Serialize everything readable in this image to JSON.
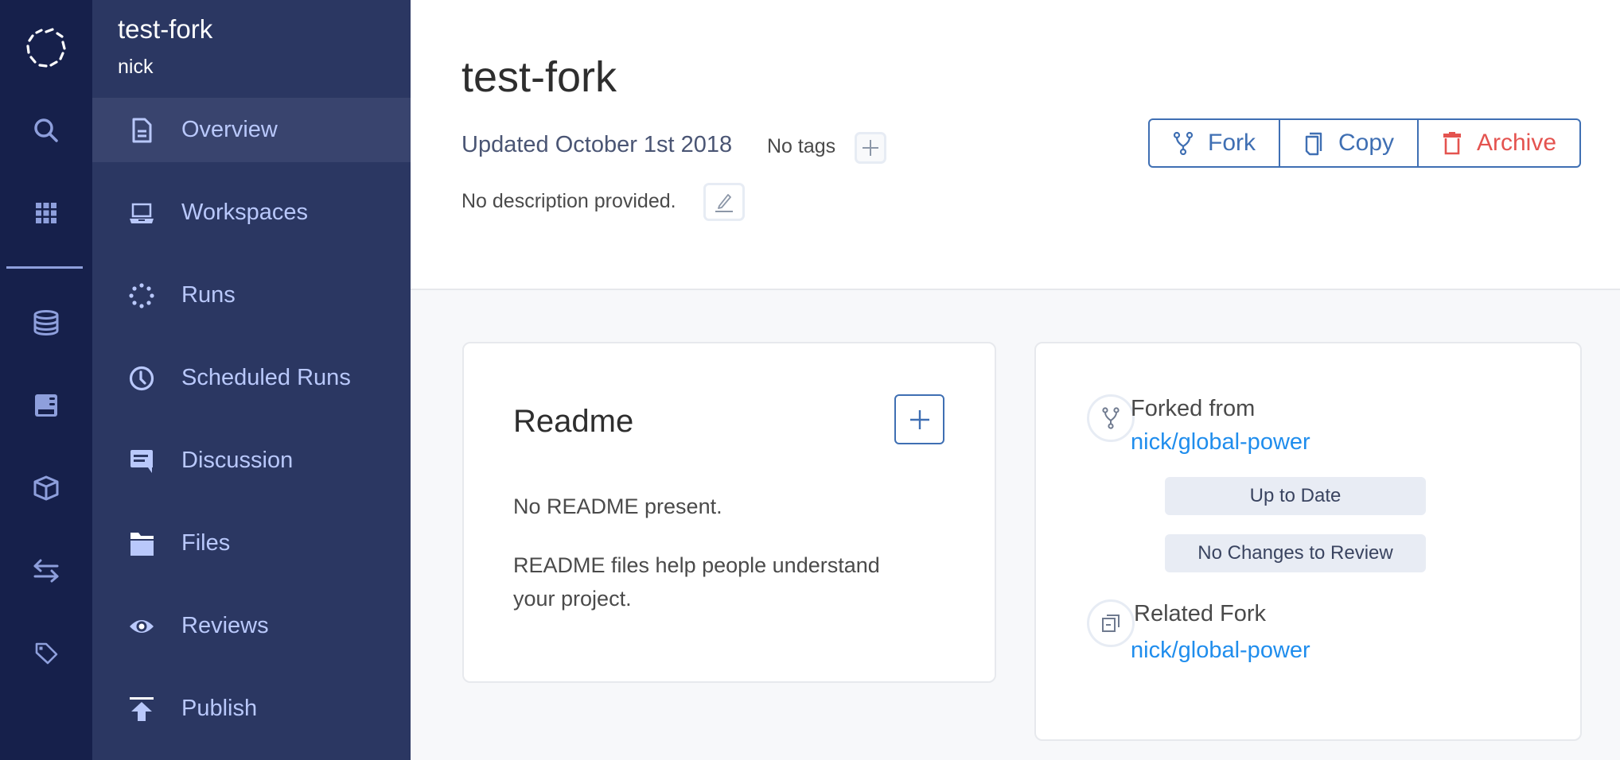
{
  "rail": {
    "items": [
      {
        "name": "logo",
        "icon": "brand-logo-icon"
      },
      {
        "name": "search",
        "icon": "search-icon"
      },
      {
        "name": "apps",
        "icon": "grid-icon"
      },
      {
        "name": "data",
        "icon": "database-icon"
      },
      {
        "name": "environments",
        "icon": "server-panel-icon"
      },
      {
        "name": "models",
        "icon": "cube-icon"
      },
      {
        "name": "exchange",
        "icon": "swap-arrows-icon"
      },
      {
        "name": "tags",
        "icon": "tag-icon"
      }
    ]
  },
  "sidebar": {
    "project_name": "test-fork",
    "owner": "nick",
    "items": [
      {
        "label": "Overview",
        "icon": "document-icon",
        "active": true
      },
      {
        "label": "Workspaces",
        "icon": "laptop-icon",
        "active": false
      },
      {
        "label": "Runs",
        "icon": "spinner-dots-icon",
        "active": false
      },
      {
        "label": "Scheduled Runs",
        "icon": "clock-icon",
        "active": false
      },
      {
        "label": "Discussion",
        "icon": "chat-bubble-icon",
        "active": false
      },
      {
        "label": "Files",
        "icon": "folder-icon",
        "active": false
      },
      {
        "label": "Reviews",
        "icon": "eye-icon",
        "active": false
      },
      {
        "label": "Publish",
        "icon": "upload-icon",
        "active": false
      }
    ]
  },
  "header": {
    "title": "test-fork",
    "updated": "Updated October 1st 2018",
    "tags_text": "No tags",
    "description": "No description provided.",
    "actions": {
      "fork": "Fork",
      "copy": "Copy",
      "archive": "Archive"
    }
  },
  "readme": {
    "title": "Readme",
    "empty_text": "No README present.",
    "help_text": "README files help people understand your project."
  },
  "fork_info": {
    "forked_from_label": "Forked from",
    "forked_from_link": "nick/global-power",
    "up_to_date_label": "Up to Date",
    "no_changes_label": "No Changes to Review",
    "related_fork_label": "Related Fork",
    "related_fork_link": "nick/global-power"
  },
  "colors": {
    "rail_bg": "#16204b",
    "sidebar_bg": "#2b3762",
    "sidebar_active_bg": "#39446e",
    "sidebar_text": "#b9c8fb",
    "primary": "#3f6fb3",
    "danger": "#e4534f",
    "link": "#1f8ded"
  }
}
